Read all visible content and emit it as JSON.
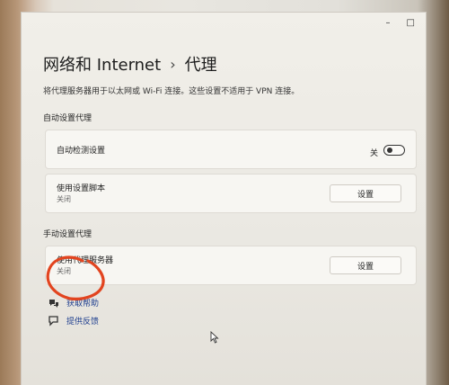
{
  "window": {
    "minimize": "–",
    "maximize": "□"
  },
  "header": {
    "section": "网络和 Internet",
    "separator": "›",
    "page": "代理"
  },
  "description": "将代理服务器用于以太网或 Wi-Fi 连接。这些设置不适用于 VPN 连接。",
  "auto_section": {
    "title": "自动设置代理",
    "detect": {
      "label": "自动检测设置",
      "toggle_state": "关"
    },
    "script": {
      "label": "使用设置脚本",
      "status": "关闭",
      "button": "设置"
    }
  },
  "manual_section": {
    "title": "手动设置代理",
    "proxy": {
      "label": "使用代理服务器",
      "status": "关闭",
      "button": "设置"
    }
  },
  "links": {
    "help": "获取帮助",
    "feedback": "提供反馈"
  },
  "colors": {
    "accent": "#1f3f8f",
    "annotation": "#e2441f"
  },
  "icons": {
    "help": "help-icon",
    "feedback": "feedback-icon"
  }
}
